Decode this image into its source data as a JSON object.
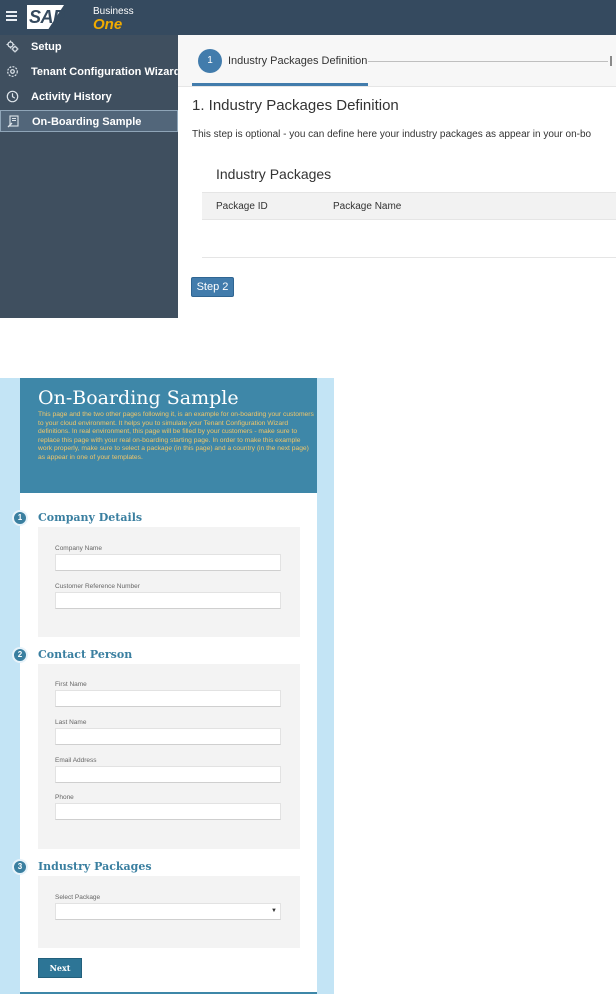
{
  "app": {
    "brand": {
      "sap": "SAP",
      "business": "Business",
      "one": "One"
    },
    "sidebar": {
      "items": [
        {
          "label": "Setup",
          "icon": "gear-cluster-icon",
          "active": false
        },
        {
          "label": "Tenant Configuration Wizard",
          "icon": "settings-icon",
          "active": false
        },
        {
          "label": "Activity History",
          "icon": "clock-icon",
          "active": false
        },
        {
          "label": "On-Boarding Sample",
          "icon": "document-edit-icon",
          "active": true
        }
      ]
    },
    "wizard": {
      "step_number": "1",
      "step_label": "Industry Packages Definition"
    },
    "content": {
      "heading": "1. Industry Packages Definition",
      "description": "This step is optional - you can define here your industry packages as appear in your on-bo",
      "table": {
        "title": "Industry Packages",
        "columns": [
          "Package ID",
          "Package Name"
        ]
      },
      "step2_label": "Step 2"
    },
    "colors": {
      "shell": "#354a5f",
      "sidebar": "#3f4f5f",
      "accent": "#427cac",
      "brand_one": "#f0ab00"
    }
  },
  "form": {
    "title": "On-Boarding Sample",
    "intro": "This page and the two other pages following it, is an example for on-boarding your customers to your cloud environment. It helps you to simulate your Tenant Configuration Wizard definitions. In real environment, this page will be filled by your customers - make sure to replace this page with your real on-boarding starting page. In order to make this example work properly, make sure to select a package (in this page) and a country (in the next page) as appear in one of your templates.",
    "sections": [
      {
        "number": "1",
        "title": "Company Details",
        "fields": [
          "Company Name",
          "Customer Reference Number"
        ]
      },
      {
        "number": "2",
        "title": "Contact Person",
        "fields": [
          "First Name",
          "Last Name",
          "Email Address",
          "Phone"
        ]
      },
      {
        "number": "3",
        "title": "Industry Packages",
        "fields": [
          "Select Package"
        ]
      }
    ],
    "next_label": "Next",
    "colors": {
      "header": "#3e87a8",
      "intro_text": "#f0c66a",
      "backdrop": "#c3e4f5"
    }
  }
}
